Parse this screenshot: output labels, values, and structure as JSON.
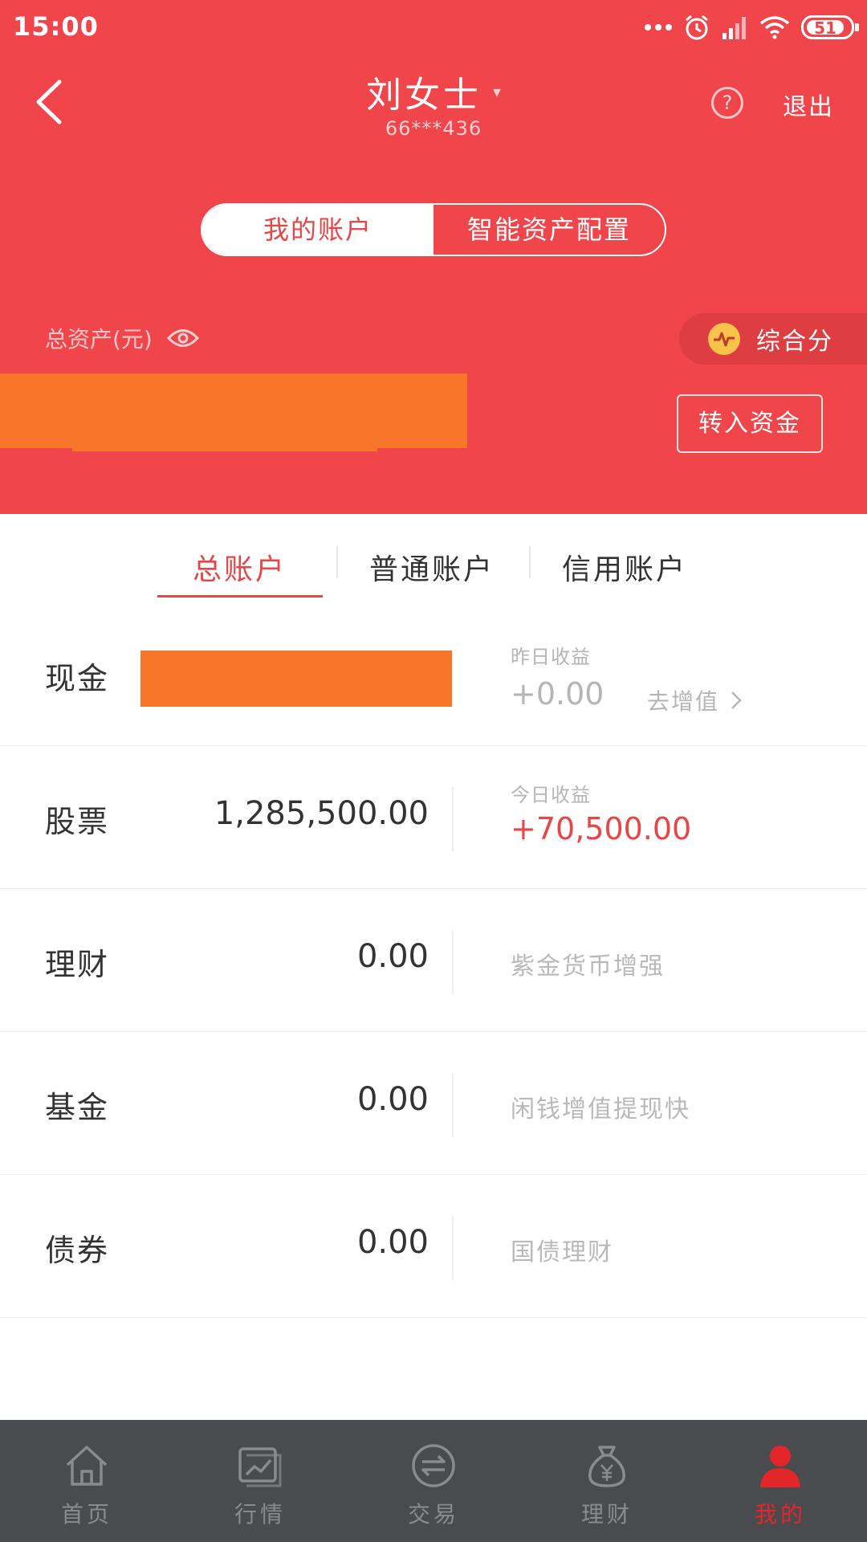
{
  "status_bar": {
    "time": "15:00",
    "battery": "51"
  },
  "header": {
    "user_name": "刘女士",
    "caret": "▾",
    "user_id": "66***436",
    "help_symbol": "?",
    "logout_label": "退出",
    "segments": {
      "active": "我的账户",
      "inactive": "智能资产配置"
    },
    "assets_label": "总资产(元)",
    "score_label": "综合分",
    "transfer_label": "转入资金",
    "total_assets_redacted": true
  },
  "account_tabs": [
    "总账户",
    "普通账户",
    "信用账户"
  ],
  "active_account_tab": 0,
  "assets": {
    "cash": {
      "label": "现金",
      "value_redacted": true,
      "sublabel": "昨日收益",
      "amount": "+0.00",
      "link_label": "去增值"
    },
    "stocks": {
      "label": "股票",
      "value": "1,285,500.00",
      "sublabel": "今日收益",
      "amount": "+70,500.00"
    },
    "wealth": {
      "label": "理财",
      "value": "0.00",
      "desc": "紫金货币增强"
    },
    "funds": {
      "label": "基金",
      "value": "0.00",
      "desc": "闲钱增值提现快"
    },
    "bonds": {
      "label": "债券",
      "value": "0.00",
      "desc": "国债理财"
    }
  },
  "bottom_nav": [
    {
      "label": "首页",
      "icon": "home-icon",
      "active": false
    },
    {
      "label": "行情",
      "icon": "market-chart-icon",
      "active": false
    },
    {
      "label": "交易",
      "icon": "trade-exchange-icon",
      "active": false
    },
    {
      "label": "理财",
      "icon": "money-bag-icon",
      "active": false
    },
    {
      "label": "我的",
      "icon": "user-icon",
      "active": true
    }
  ],
  "colors": {
    "header_red": "#f0454a",
    "accent_red": "#e84546",
    "redaction_orange": "#f77629",
    "nav_bg": "#4a4b4e"
  }
}
